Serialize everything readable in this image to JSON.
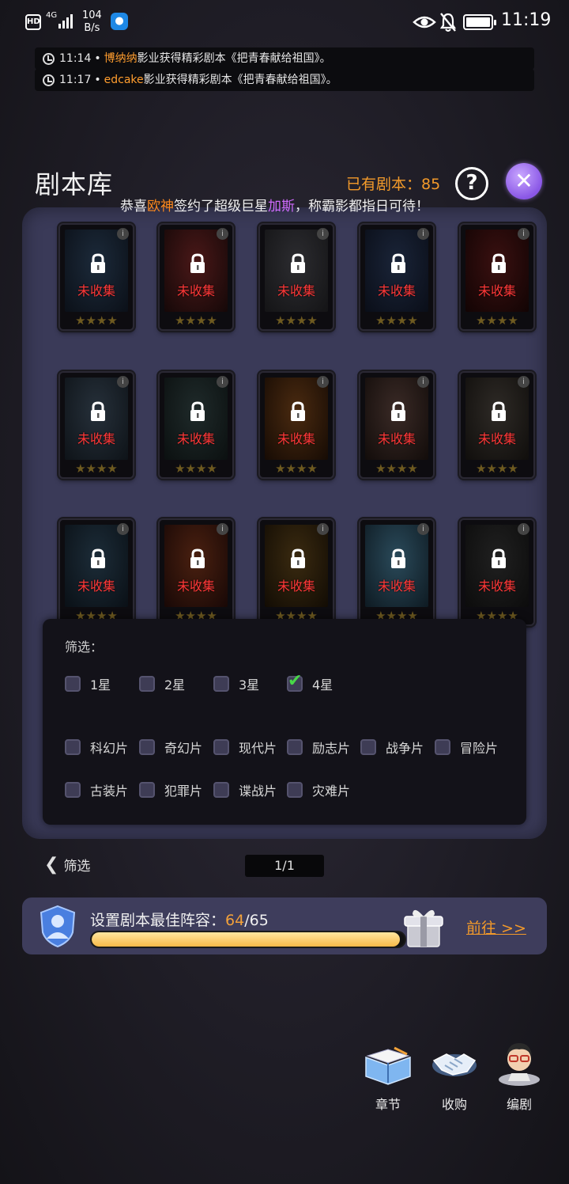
{
  "statusbar": {
    "hd": "HD",
    "network": "4G",
    "speed_value": "104",
    "speed_unit": "B/s",
    "time": "11:19",
    "icons": [
      "signal-icon",
      "bulb-icon",
      "eye-icon",
      "mute-bell-icon",
      "battery-icon"
    ]
  },
  "notifications": [
    {
      "time": "11:14",
      "name": "博纳纳",
      "text": "影业获得精彩剧本《把青春献给祖国》。"
    },
    {
      "time": "11:17",
      "name": "edcake",
      "text": "影业获得精彩剧本《把青春献给祖国》。"
    }
  ],
  "header": {
    "title": "剧本库",
    "count_label": "已有剧本：85",
    "help_label": "?",
    "close_label": "✕"
  },
  "congrats": {
    "prefix": "恭喜",
    "company": "欧神",
    "middle": "签约了超级巨星",
    "star": "加斯",
    "suffix": "，称霸影都指日可待！"
  },
  "cards": {
    "status_label": "未收集",
    "stars": "★★★★",
    "info": "i",
    "arts": [
      [
        "#1c2a3a",
        "#0b1018"
      ],
      [
        "#4a1818",
        "#150808"
      ],
      [
        "#2c2c30",
        "#141416"
      ],
      [
        "#1a2438",
        "#0a0e18"
      ],
      [
        "#3a1010",
        "#120404"
      ],
      [
        "#26303a",
        "#0e1318"
      ],
      [
        "#1f2a2a",
        "#0b1010"
      ],
      [
        "#4a2a10",
        "#160b04"
      ],
      [
        "#3a2a26",
        "#120c0a"
      ],
      [
        "#2e2a26",
        "#100e0c"
      ],
      [
        "#1c2c38",
        "#0a1016"
      ],
      [
        "#4a2010",
        "#180806"
      ],
      [
        "#3a2a10",
        "#120c04"
      ],
      [
        "#2a4a5a",
        "#0e1a22"
      ],
      [
        "#202020",
        "#0c0c0c"
      ]
    ]
  },
  "filter": {
    "title": "筛选：",
    "stars": [
      {
        "label": "1星",
        "checked": false
      },
      {
        "label": "2星",
        "checked": false
      },
      {
        "label": "3星",
        "checked": false
      },
      {
        "label": "4星",
        "checked": true
      }
    ],
    "genres_row1": [
      "科幻片",
      "奇幻片",
      "现代片",
      "励志片",
      "战争片",
      "冒险片"
    ],
    "genres_row2": [
      "古装片",
      "犯罪片",
      "谍战片",
      "灾难片"
    ]
  },
  "nav": {
    "back_label": "筛选",
    "page": "1/1"
  },
  "lineup": {
    "label": "设置剧本最佳阵容：",
    "current": "64",
    "total": "/65",
    "progress": 0.985,
    "goto_label": "前往 >>"
  },
  "actions": [
    {
      "label": "章节",
      "icon": "book-icon"
    },
    {
      "label": "收购",
      "icon": "handshake-icon"
    },
    {
      "label": "编剧",
      "icon": "writer-avatar-icon"
    }
  ]
}
